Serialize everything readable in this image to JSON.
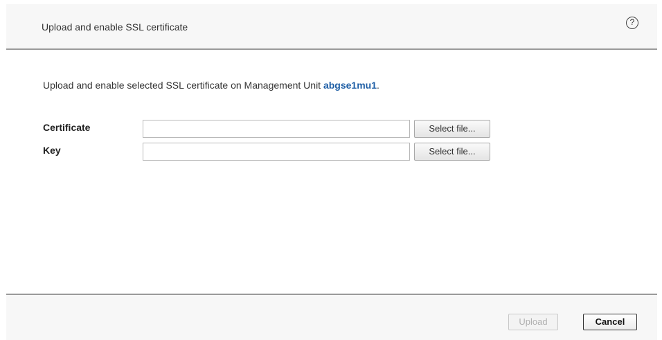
{
  "header": {
    "title": "Upload and enable SSL certificate",
    "help_glyph": "?"
  },
  "intro": {
    "prefix": "Upload and enable selected SSL certificate on Management Unit ",
    "unit_name": "abgse1mu1",
    "suffix": "."
  },
  "form": {
    "certificate": {
      "label": "Certificate",
      "value": "",
      "button_label": "Select file..."
    },
    "key": {
      "label": "Key",
      "value": "",
      "button_label": "Select file..."
    }
  },
  "footer": {
    "upload_label": "Upload",
    "upload_enabled": false,
    "cancel_label": "Cancel"
  },
  "colors": {
    "link_accent": "#1f5fa6",
    "header_bg": "#f7f7f7",
    "divider": "#9a9a9a"
  },
  "icons": {
    "help": "help-circle-icon"
  }
}
